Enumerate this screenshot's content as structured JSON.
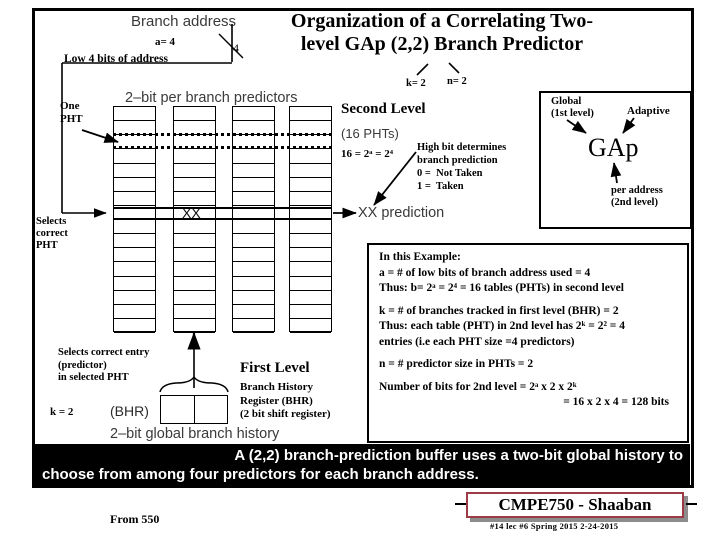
{
  "title": "Organization of a Correlating Two-level GAp (2,2) Branch Predictor",
  "top": {
    "branch_address": "Branch address",
    "a_label": "a= 4",
    "bits_label": "4",
    "low_bits": "Low 4 bits of address"
  },
  "title_annotations": {
    "k": "k= 2",
    "n": "n= 2"
  },
  "pht": {
    "predictors_label": "2–bit per branch predictors",
    "one": "One",
    "pht": "PHT",
    "selects_correct": "Selects\ncorrect\nPHT",
    "xx_cell": "XX",
    "columns": 4,
    "rows": 16
  },
  "second_level": {
    "heading": "Second Level",
    "count": "(16 PHTs)",
    "equation": "16 = 2ᵃ = 2⁴",
    "high_bit": "High bit determines\nbranch prediction\n0 =  Not Taken\n1 =  Taken",
    "prediction_out": "XX prediction"
  },
  "gap_box": {
    "global": "Global\n(1st level)",
    "adaptive": "Adaptive",
    "word": "GAp",
    "per_address": "per address\n(2nd level)"
  },
  "example": {
    "heading": "In this Example:",
    "line_a": "a = # of low bits of branch address used  = 4",
    "line_b": "Thus:  b= 2ᵃ =  2⁴ = 16   tables (PHTs) in second level",
    "line_k": "k =  # of branches tracked  in first level (BHR) = 2",
    "line_k2": "Thus: each table (PHT) in 2nd level  has  2ᵏ = 2² = 4",
    "line_k3": "entries  (i.e each PHT size  =4 predictors)",
    "line_n": "n =  #  predictor size in PHTs = 2",
    "line_bits": "Number of bits for 2nd level = 2ᵃ x 2 x 2ᵏ",
    "line_bits2": "=  16 x  2 x  4 = 128 bits"
  },
  "first_level": {
    "selects_entry": "Selects correct entry\n(predictor)\nin selected PHT",
    "k": "k = 2",
    "bhr_inline": "(BHR)",
    "heading": "First Level",
    "description": "Branch History\nRegister (BHR)\n(2 bit shift register)",
    "global_history": "2–bit global branch history"
  },
  "banner": {
    "line1": "A (2,2) branch-prediction buffer uses a two-bit global history to",
    "line2": "choose from among four predictors for each branch address."
  },
  "footer": {
    "from": "From 550",
    "course": "CMPE750 - Shaaban",
    "meta": "#14  lec #6   Spring 2015  2-24-2015"
  },
  "colors": {
    "accent": "#9c3a46",
    "banner_bg": "#000000",
    "text": "#000000",
    "sans_gray": "#3a3a3a"
  }
}
